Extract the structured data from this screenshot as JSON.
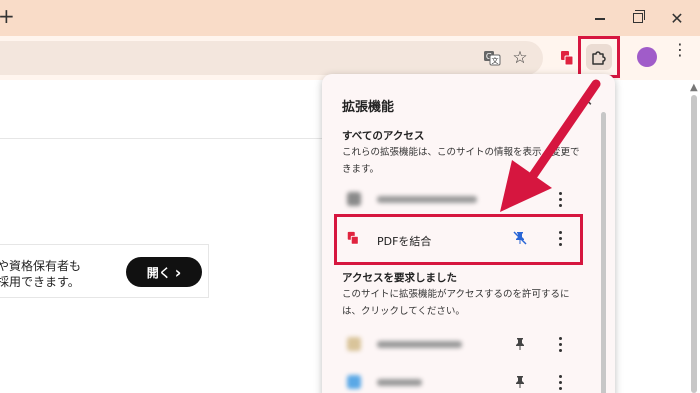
{
  "window": {
    "new_tab_glyph": "+",
    "close_glyph": "✕"
  },
  "toolbar": {
    "star_glyph": "☆",
    "menu_glyph": "⋮"
  },
  "page": {
    "banner_line1": "や資格保有者も",
    "banner_line2": "採用できます。",
    "open_button_label": "開く",
    "open_button_chevron": "›"
  },
  "extensions_panel": {
    "title": "拡張機能",
    "close_glyph": "✕",
    "full_access_title": "すべてのアクセス",
    "full_access_desc": "これらの拡張機能は、このサイトの情報を表示・変更できます。",
    "pdf_extension_name": "PDFを結合",
    "request_access_title": "アクセスを要求しました",
    "request_access_desc": "このサイトに拡張機能がアクセスするのを許可するには、クリックしてください。"
  },
  "colors": {
    "highlight_red": "#d6163f",
    "titlebar": "#f9dcc8",
    "toolbar": "#fff5ee",
    "avatar": "#a05cc9"
  }
}
